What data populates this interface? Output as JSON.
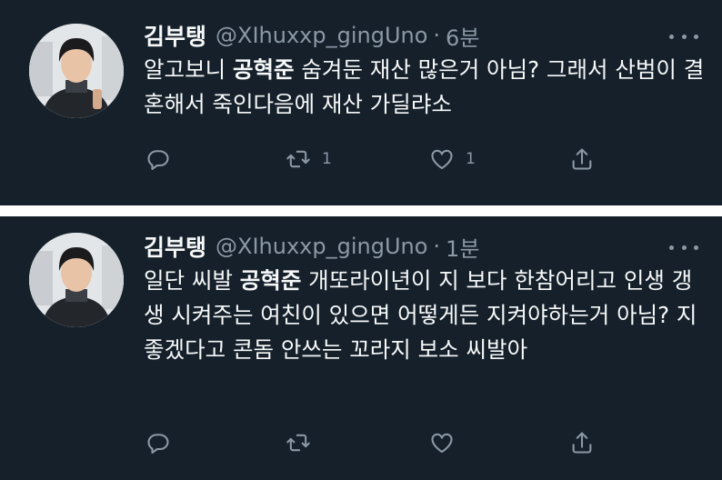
{
  "tweets": [
    {
      "name": "김부탱",
      "handle": "@XIhuxxp_gingUno",
      "separator": "·",
      "time": "6분",
      "text_pre": "알고보니 ",
      "text_bold": "공혁준",
      "text_post": " 숨겨둔 재산 많은거 아님? 그래서 산범이 결혼해서 죽인다음에 재산 가딜랴소",
      "retweet_count": "1",
      "like_count": "1"
    },
    {
      "name": "김부탱",
      "handle": "@XIhuxxp_gingUno",
      "separator": "·",
      "time": "1분",
      "text_pre": "일단 씨발 ",
      "text_bold": "공혁준",
      "text_post": " 개또라이년이 지 보다 한참어리고 인생 갱생 시켜주는 여친이 있으면 어떻게든 지켜야하는거 아님? 지 좋겠다고 콘돔 안쓰는 꼬라지 보소 씨발아",
      "retweet_count": "",
      "like_count": ""
    }
  ],
  "icons": {
    "reply": "reply-icon",
    "retweet": "retweet-icon",
    "like": "heart-icon",
    "share": "share-icon",
    "more": "more-icon"
  },
  "colors": {
    "background": "#15202b",
    "text": "#f7f9f9",
    "muted": "#8b98a5",
    "separator": "#ffffff"
  }
}
